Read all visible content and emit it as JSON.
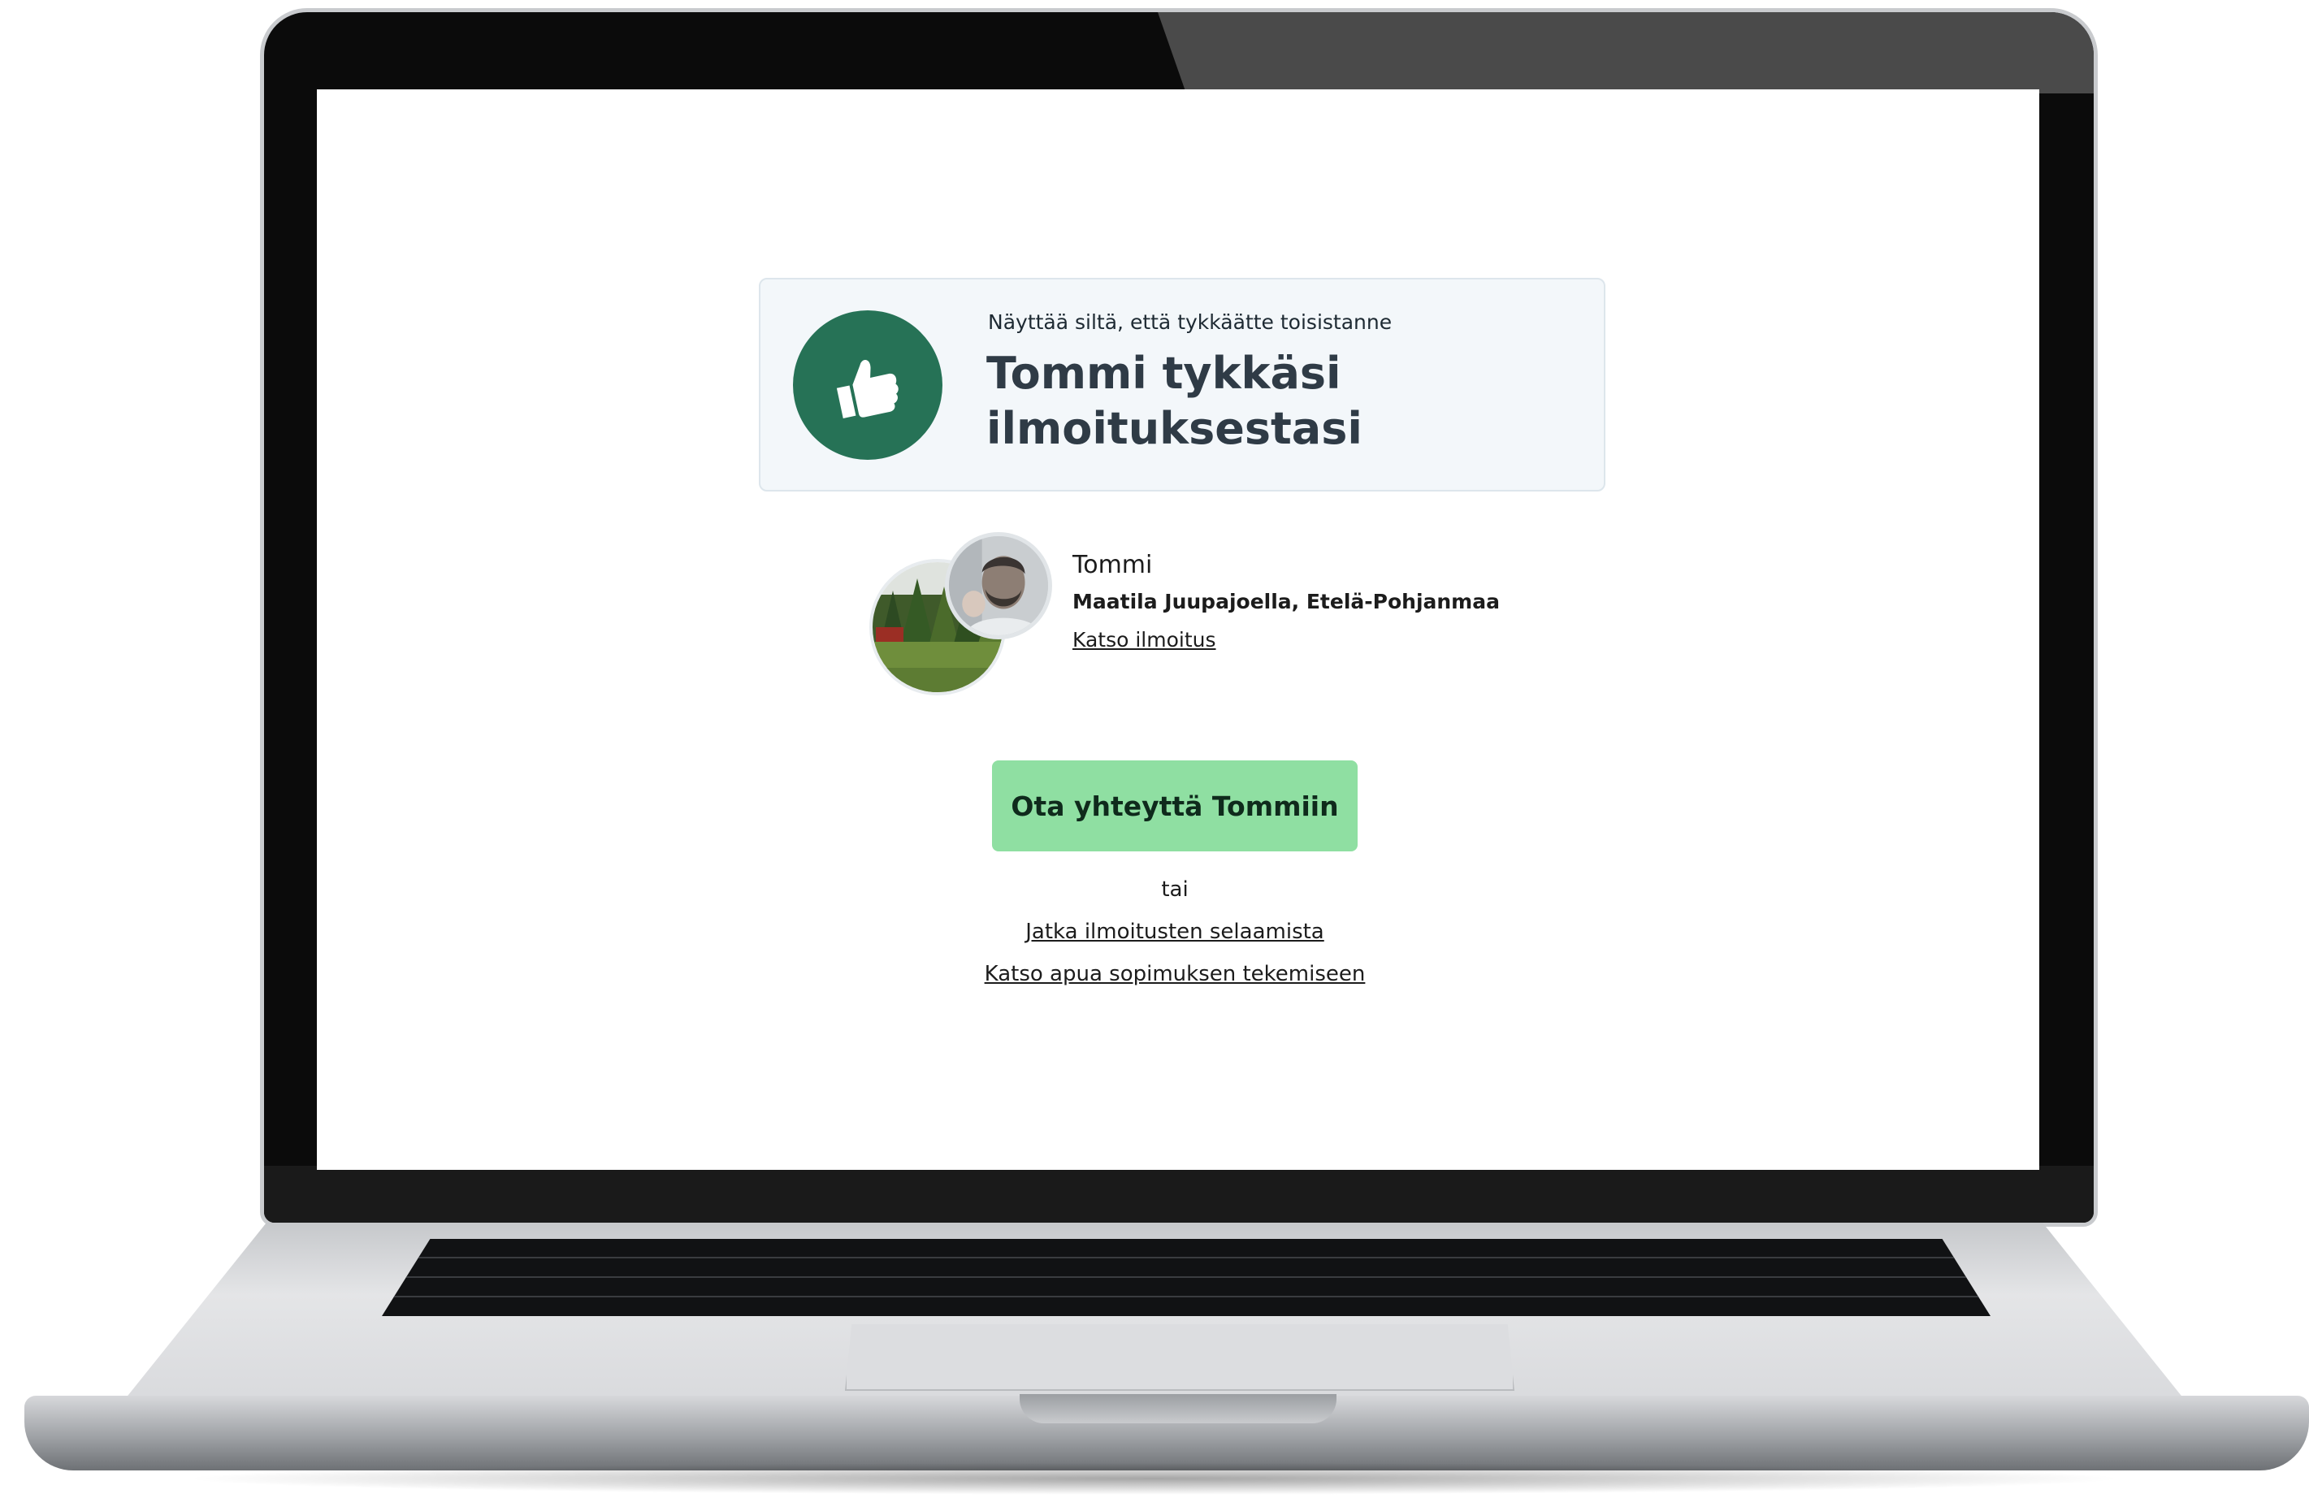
{
  "notice": {
    "subtitle": "Näyttää siltä, että tykkäätte toisistanne",
    "title": "Tommi tykkäsi ilmoituksestasi",
    "icon": "thumbs-up-icon",
    "accent_color": "#267256"
  },
  "profile": {
    "name": "Tommi",
    "location": "Maatila Juupajoella, Etelä-Pohjanmaa",
    "view_listing_link": "Katso ilmoitus"
  },
  "actions": {
    "contact_button": "Ota yhteyttä Tommiin",
    "contact_button_color": "#8fdfa2",
    "or_text": "tai",
    "continue_browsing_link": "Jatka ilmoitusten selaamista",
    "help_link": "Katso apua sopimuksen tekemiseen"
  }
}
